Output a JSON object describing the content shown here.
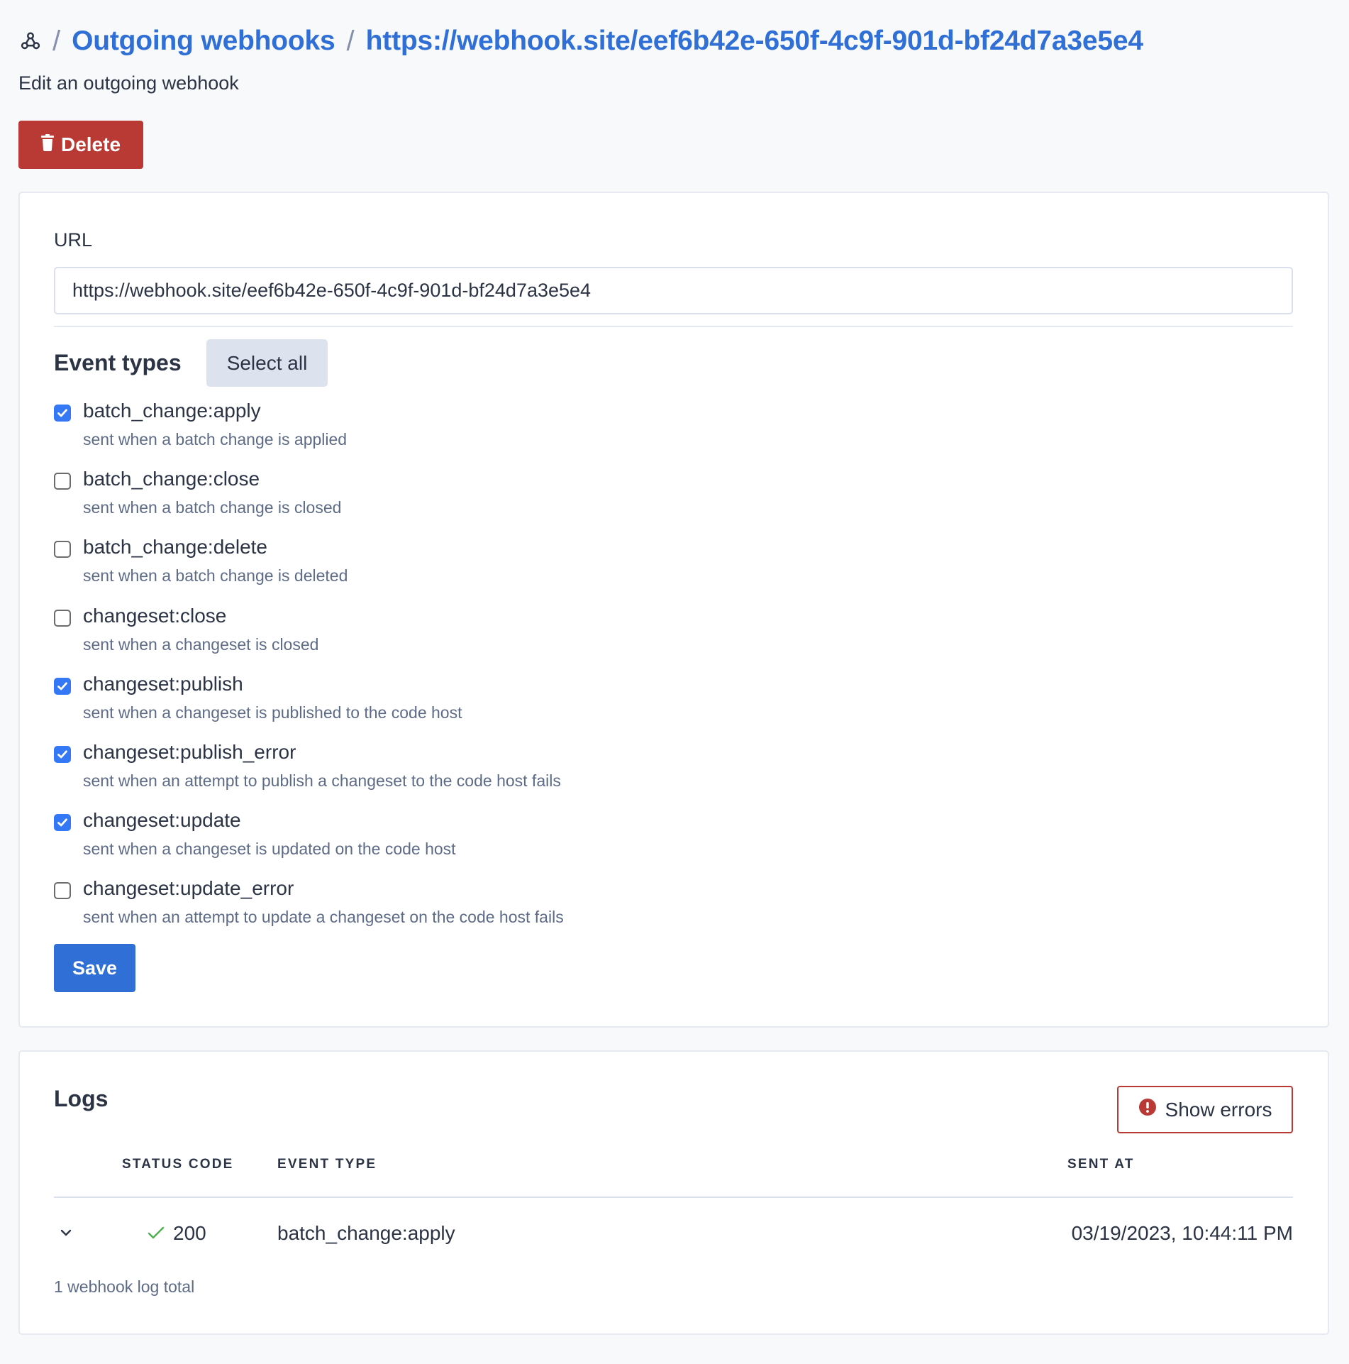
{
  "breadcrumb": {
    "icon": "webhook-icon",
    "separator": "/",
    "items": [
      {
        "label": "Outgoing webhooks"
      },
      {
        "label": "https://webhook.site/eef6b42e-650f-4c9f-901d-bf24d7a3e5e4"
      }
    ]
  },
  "header": {
    "subtitle": "Edit an outgoing webhook",
    "delete_label": "Delete",
    "delete_icon": "trash-icon"
  },
  "form": {
    "url_label": "URL",
    "url_value": "https://webhook.site/eef6b42e-650f-4c9f-901d-bf24d7a3e5e4",
    "event_types_heading": "Event types",
    "select_all_label": "Select all",
    "event_types": [
      {
        "name": "batch_change:apply",
        "description": "sent when a batch change is applied",
        "checked": true
      },
      {
        "name": "batch_change:close",
        "description": "sent when a batch change is closed",
        "checked": false
      },
      {
        "name": "batch_change:delete",
        "description": "sent when a batch change is deleted",
        "checked": false
      },
      {
        "name": "changeset:close",
        "description": "sent when a changeset is closed",
        "checked": false
      },
      {
        "name": "changeset:publish",
        "description": "sent when a changeset is published to the code host",
        "checked": true
      },
      {
        "name": "changeset:publish_error",
        "description": "sent when an attempt to publish a changeset to the code host fails",
        "checked": true
      },
      {
        "name": "changeset:update",
        "description": "sent when a changeset is updated on the code host",
        "checked": true
      },
      {
        "name": "changeset:update_error",
        "description": "sent when an attempt to update a changeset on the code host fails",
        "checked": false
      }
    ],
    "save_label": "Save"
  },
  "logs": {
    "heading": "Logs",
    "show_errors_label": "Show errors",
    "show_errors_icon": "error-circle-icon",
    "columns": [
      "STATUS CODE",
      "EVENT TYPE",
      "SENT AT"
    ],
    "rows": [
      {
        "status_code": "200",
        "status_icon": "check-icon",
        "event_type": "batch_change:apply",
        "sent_at": "03/19/2023, 10:44:11 PM"
      }
    ],
    "total_text": "1 webhook log total"
  },
  "colors": {
    "link": "#2f6fd6",
    "danger": "#b93a34",
    "primary": "#2f6fd6",
    "checkbox_checked": "#3478f6",
    "success": "#4caf50",
    "secondary_button": "#dde2ef"
  }
}
